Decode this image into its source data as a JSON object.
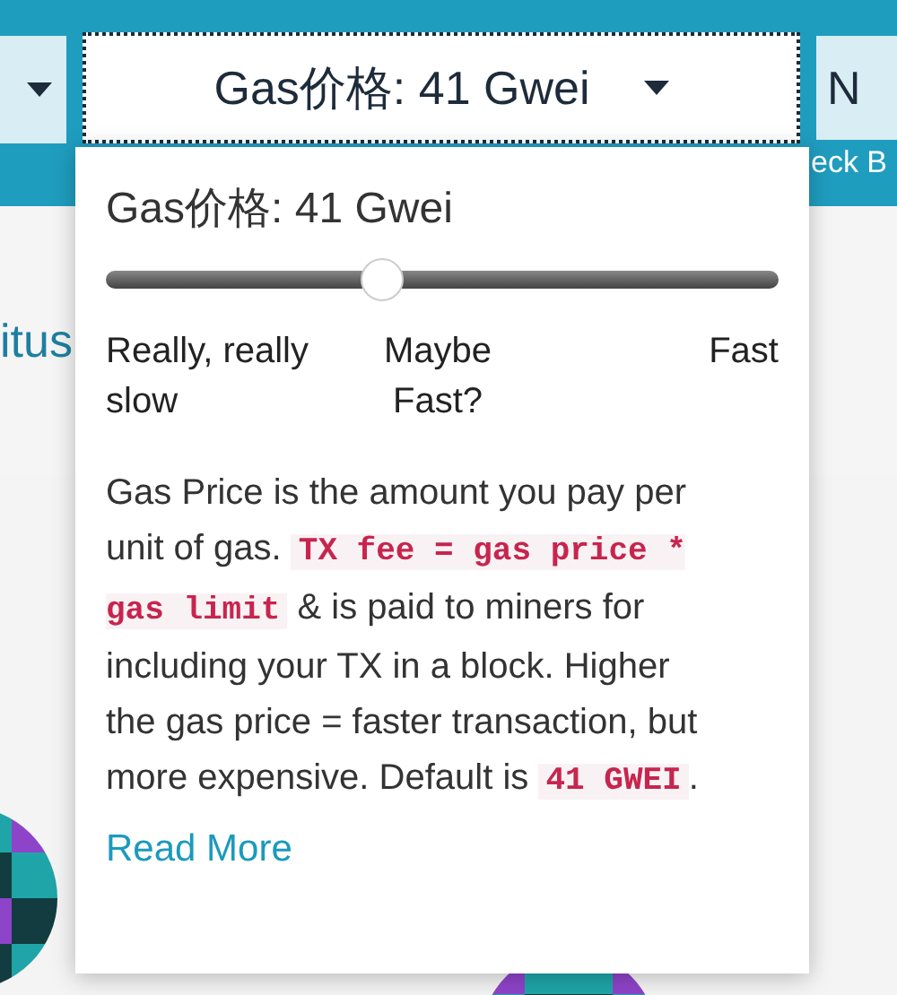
{
  "toolbar": {
    "gas_button": {
      "label": "Gas价格: 41 Gwei"
    },
    "right_button": {
      "label": "N"
    },
    "subtext": "eck B"
  },
  "page": {
    "status_text": "itus"
  },
  "gas_popup": {
    "title": "Gas价格: 41 Gwei",
    "slider": {
      "level": 0.41
    },
    "speed_labels": [
      "Really, really slow",
      "Maybe Fast?",
      "Fast"
    ],
    "description": [
      {
        "kind": "text",
        "text": "Gas Price is the amount you pay per unit of gas. "
      },
      {
        "kind": "code",
        "text": "TX fee = gas price * gas limit"
      },
      {
        "kind": "text",
        "text": " & is paid to miners for including your TX in a block. Higher the gas price = faster transaction, but more expensive. Default is "
      },
      {
        "kind": "code",
        "text": "41 GWEI"
      },
      {
        "kind": "text",
        "text": "."
      }
    ],
    "link": "Read More"
  }
}
